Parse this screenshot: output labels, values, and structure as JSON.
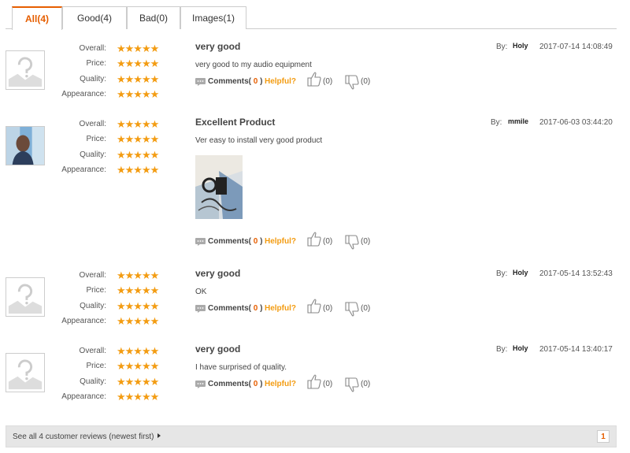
{
  "tabs": [
    {
      "label": "All(4)",
      "active": true
    },
    {
      "label": "Good(4)",
      "active": false
    },
    {
      "label": "Bad(0)",
      "active": false
    },
    {
      "label": "Images(1)",
      "active": false
    }
  ],
  "rating_labels": {
    "overall": "Overall:",
    "price": "Price:",
    "quality": "Quality:",
    "appearance": "Appearance:"
  },
  "stars": "★★★★★",
  "by_label": "By:",
  "comments_label": "Comments(",
  "comments_close": ")",
  "helpful_label": "Helpful?",
  "reviews": [
    {
      "title": "very good",
      "author": "Holy",
      "date": "2017-07-14 14:08:49",
      "body": "very good to my audio equipment",
      "comments": "0",
      "up": "(0)",
      "down": "(0)",
      "ratings": {
        "overall": 5,
        "price": 5,
        "quality": 5,
        "appearance": 5
      }
    },
    {
      "title": "Excellent Product",
      "author": "mmile",
      "date": "2017-06-03 03:44:20",
      "body": "Ver easy to install very good product",
      "comments": "0",
      "up": "(0)",
      "down": "(0)",
      "ratings": {
        "overall": 5,
        "price": 5,
        "quality": 5,
        "appearance": 5
      }
    },
    {
      "title": "very good",
      "author": "Holy",
      "date": "2017-05-14 13:52:43",
      "body": "OK",
      "comments": "0",
      "up": "(0)",
      "down": "(0)",
      "ratings": {
        "overall": 5,
        "price": 5,
        "quality": 5,
        "appearance": 5
      }
    },
    {
      "title": "very good",
      "author": "Holy",
      "date": "2017-05-14 13:40:17",
      "body": "I have surprised of quality.",
      "comments": "0",
      "up": "(0)",
      "down": "(0)",
      "ratings": {
        "overall": 5,
        "price": 5,
        "quality": 5,
        "appearance": 5
      }
    }
  ],
  "footer": {
    "see_all": "See all 4 customer reviews (newest first)",
    "page": "1"
  },
  "colors": {
    "accent": "#e65e00",
    "star": "#f39c12",
    "helpful": "#f39c12"
  }
}
